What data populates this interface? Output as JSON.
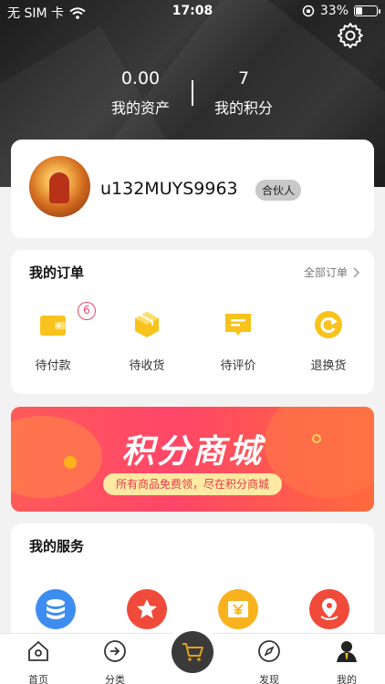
{
  "status_bar": {
    "carrier": "无 SIM 卡",
    "time": "17:08",
    "battery": "33%",
    "battery_level": 0.33
  },
  "stats": [
    {
      "value": "0.00",
      "label": "我的资产"
    },
    {
      "value": "7",
      "label": "我的积分"
    }
  ],
  "profile": {
    "username": "u132MUYS9963",
    "badge": "合伙人"
  },
  "orders": {
    "title": "我的订单",
    "more_label": "全部订单",
    "pending_payment_count": "6",
    "items": [
      {
        "label": "待付款",
        "icon": "wallet-icon"
      },
      {
        "label": "待收货",
        "icon": "package-icon"
      },
      {
        "label": "待评价",
        "icon": "comment-icon"
      },
      {
        "label": "退换货",
        "icon": "refresh-icon"
      }
    ]
  },
  "banner": {
    "title": "积分商城",
    "subtitle": "所有商品免费领，尽在积分商城"
  },
  "services": {
    "title": "我的服务",
    "icons": [
      {
        "icon": "database-icon",
        "color": "#3d8df0"
      },
      {
        "icon": "star-icon",
        "color": "#f04a3a"
      },
      {
        "icon": "yen-ticket-icon",
        "color": "#f7b21e"
      },
      {
        "icon": "location-icon",
        "color": "#f04a3a"
      }
    ]
  },
  "tabbar": [
    {
      "label": "首页",
      "icon": "home-icon"
    },
    {
      "label": "分类",
      "icon": "category-icon"
    },
    {
      "label": "",
      "icon": "cart-icon"
    },
    {
      "label": "发现",
      "icon": "compass-icon"
    },
    {
      "label": "我的",
      "icon": "user-icon",
      "active": true
    }
  ],
  "colors": {
    "accent_yellow": "#f9c31d",
    "badge_red": "#e64a6a",
    "banner_red": "#ff4668"
  }
}
